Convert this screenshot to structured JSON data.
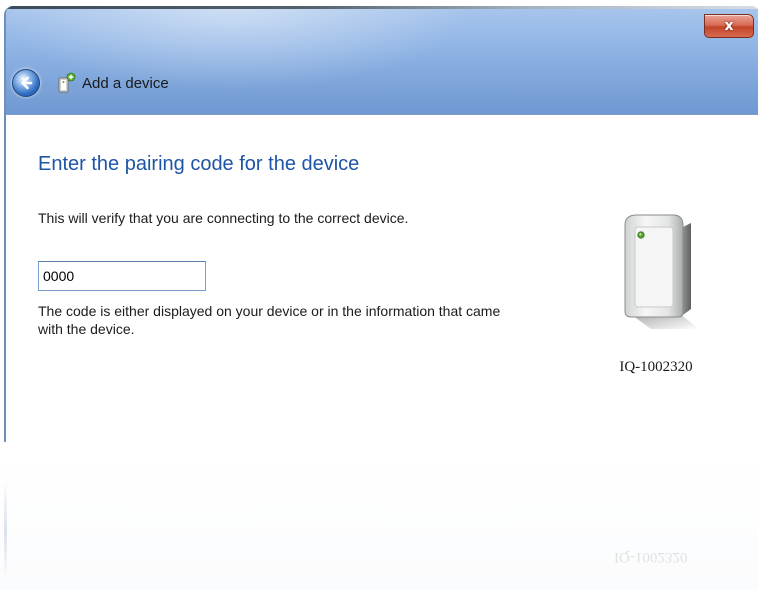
{
  "window": {
    "title": "Add a device",
    "close_label": "x"
  },
  "page": {
    "heading": "Enter the pairing code for the device",
    "instruction": "This will verify that you are connecting to the correct device.",
    "code_value": "0000",
    "hint": "The code is either displayed on your device or in the information that came with the device."
  },
  "device": {
    "name": "IQ-1002320",
    "icon": "device-tower-icon"
  },
  "icons": {
    "back": "back-arrow-icon",
    "title_icon": "add-device-icon",
    "close": "close-icon"
  },
  "colors": {
    "heading": "#1e55a5",
    "titlebar": "#92b6e6",
    "close": "#c2452b"
  }
}
